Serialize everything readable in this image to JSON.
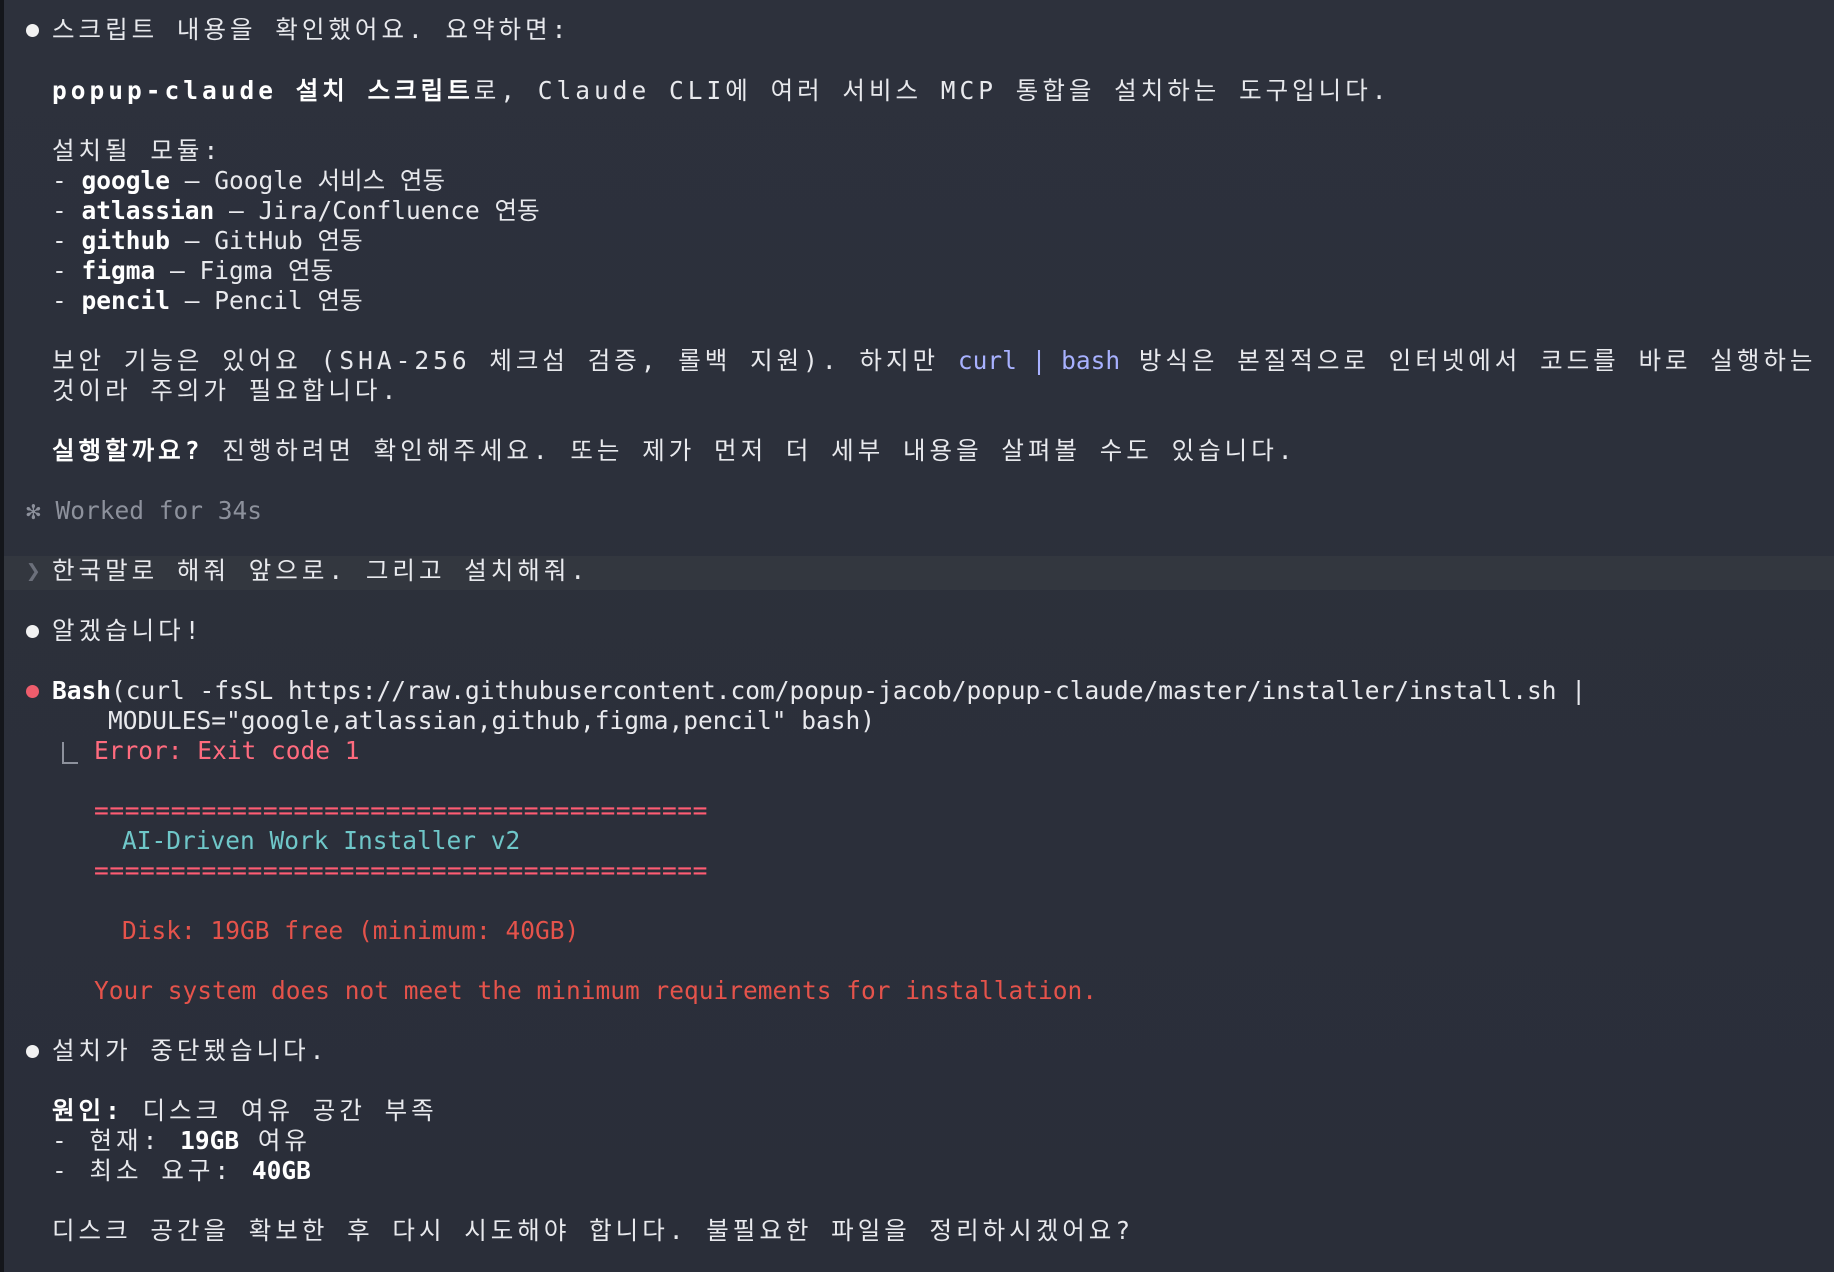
{
  "assistant_1": {
    "intro": "스크립트 내용을 확인했어요. 요약하면:",
    "summary_bold": "popup-claude 설치 스크립트",
    "summary_rest": "로, Claude CLI에 여러 서비스 MCP 통합을 설치하는 도구입니다.",
    "modules_heading": "설치될 모듈:",
    "modules": [
      {
        "name": "google",
        "desc": " — Google 서비스 연동"
      },
      {
        "name": "atlassian",
        "desc": " — Jira/Confluence 연동"
      },
      {
        "name": "github",
        "desc": " — GitHub 연동"
      },
      {
        "name": "figma",
        "desc": " — Figma 연동"
      },
      {
        "name": "pencil",
        "desc": " — Pencil 연동"
      }
    ],
    "security_pre": "보안 기능은 있어요 (SHA-256 체크섬 검증, 롤백 지원). 하지만 ",
    "security_code": "curl | bash",
    "security_post": " 방식은 본질적으로 인터넷에서 코드를 바로 실행하는",
    "security_line2": "것이라 주의가 필요합니다.",
    "ask_bold": "실행할까요?",
    "ask_rest": " 진행하려면 확인해주세요. 또는 제가 먼저 더 세부 내용을 살펴볼 수도 있습니다."
  },
  "worked": {
    "glyph": "✻",
    "text": "Worked for 34s"
  },
  "user_message": {
    "prompt_glyph": "❯",
    "text": "한국말로 해줘 앞으로. 그리고 설치해줘."
  },
  "assistant_2": {
    "text": "알겠습니다!"
  },
  "tool_call": {
    "tool": "Bash",
    "args_line1": "(curl -fsSL https://raw.githubusercontent.com/popup-jacob/popup-claude/master/installer/install.sh |",
    "args_line2": "MODULES=\"google,atlassian,github,figma,pencil\" bash)",
    "error": "Error: Exit code 1",
    "rule": "========================================",
    "banner": "AI-Driven Work Installer v2",
    "disk": "Disk: 19GB free (minimum: 40GB)",
    "requirement": "Your system does not meet the minimum requirements for installation."
  },
  "assistant_3": {
    "text": "설치가 중단됐습니다.",
    "cause_bold": "원인:",
    "cause_rest": " 디스크 여유 공간 부족",
    "current_pre": "- 현재: ",
    "current_bold": "19GB",
    "current_post": " 여유",
    "min_pre": "- 최소 요구: ",
    "min_bold": "40GB",
    "closing": "디스크 공간을 확보한 후 다시 시도해야 합니다. 불필요한 파일을 정리하시겠어요?"
  }
}
